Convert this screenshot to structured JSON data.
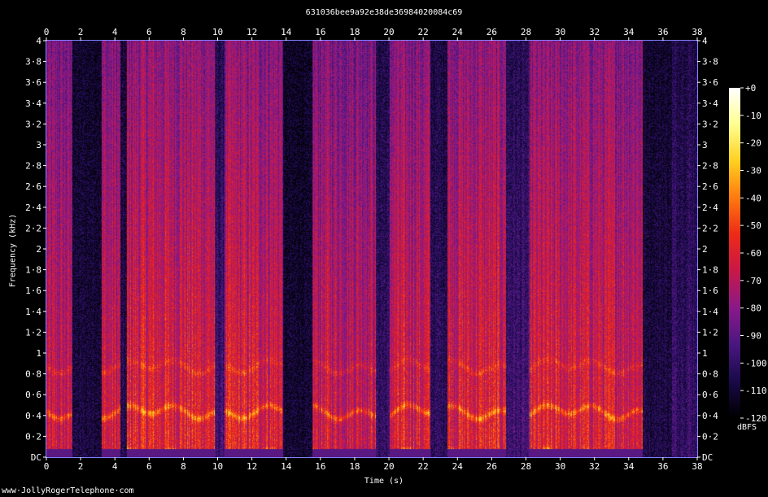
{
  "chart_data": {
    "type": "heatmap",
    "title": "631036bee9a92e38de36984020084c69",
    "xlabel": "Time (s)",
    "ylabel": "Frequency (kHz)",
    "x_range": [
      0,
      38
    ],
    "y_range": [
      0,
      4
    ],
    "x_ticks": [
      "0",
      "2",
      "4",
      "6",
      "8",
      "10",
      "12",
      "14",
      "16",
      "18",
      "20",
      "22",
      "24",
      "26",
      "28",
      "30",
      "32",
      "34",
      "36",
      "38"
    ],
    "y_ticks": [
      "DC",
      "0·2",
      "0·4",
      "0·6",
      "0·8",
      "1",
      "1·2",
      "1·4",
      "1·6",
      "1·8",
      "2",
      "2·2",
      "2·4",
      "2·6",
      "2·8",
      "3",
      "3·2",
      "3·4",
      "3·6",
      "3·8",
      "4"
    ],
    "colorbar": {
      "label": "dBFS",
      "range": [
        -120,
        0
      ],
      "ticks": [
        "+0",
        "-10",
        "-20",
        "-30",
        "-40",
        "-50",
        "-60",
        "-70",
        "-80",
        "-90",
        "-100",
        "-110",
        "-120"
      ]
    },
    "colormap": [
      "#000000",
      "#1a0a4a",
      "#4a1780",
      "#8a1a8a",
      "#c8184a",
      "#ee2a18",
      "#ff7a10",
      "#ffd020",
      "#ffff90",
      "#ffffff"
    ],
    "activity": [
      {
        "t": [
          0.0,
          1.5
        ],
        "level": 0.78
      },
      {
        "t": [
          1.5,
          3.2
        ],
        "level": 0.18
      },
      {
        "t": [
          3.2,
          4.3
        ],
        "level": 0.82
      },
      {
        "t": [
          4.3,
          4.7
        ],
        "level": 0.22
      },
      {
        "t": [
          4.7,
          9.8
        ],
        "level": 0.9
      },
      {
        "t": [
          9.8,
          10.4
        ],
        "level": 0.35
      },
      {
        "t": [
          10.4,
          13.8
        ],
        "level": 0.88
      },
      {
        "t": [
          13.8,
          15.5
        ],
        "level": 0.14
      },
      {
        "t": [
          15.5,
          19.2
        ],
        "level": 0.82
      },
      {
        "t": [
          19.2,
          20.0
        ],
        "level": 0.3
      },
      {
        "t": [
          20.0,
          22.4
        ],
        "level": 0.85
      },
      {
        "t": [
          22.4,
          23.4
        ],
        "level": 0.28
      },
      {
        "t": [
          23.4,
          26.8
        ],
        "level": 0.88
      },
      {
        "t": [
          26.8,
          28.2
        ],
        "level": 0.35
      },
      {
        "t": [
          28.2,
          34.8
        ],
        "level": 0.86
      },
      {
        "t": [
          34.8,
          36.5
        ],
        "level": 0.2
      },
      {
        "t": [
          36.5,
          38.0
        ],
        "level": 0.32
      }
    ]
  },
  "footer": {
    "website": "www·JollyRogerTelephone·com"
  }
}
